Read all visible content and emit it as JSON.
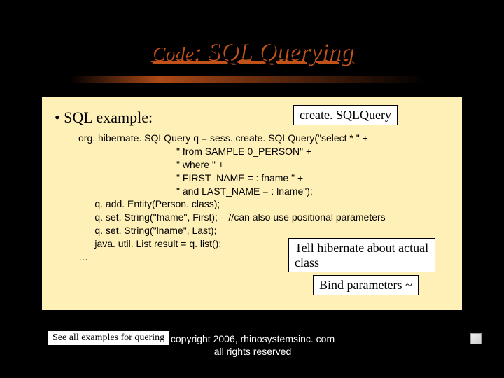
{
  "title": {
    "w1": "Code",
    "w2": ": SQL Querying"
  },
  "bullet": "SQL example:",
  "callouts": {
    "createSQLQuery": "create. SQLQuery",
    "tellHibernate": "Tell hibernate about actual class",
    "bindParams": "Bind parameters ~"
  },
  "code": "org. hibernate. SQLQuery q = sess. create. SQLQuery(\"select * \" +\n                                    \" from SAMPLE 0_PERSON\" +\n                                    \" where \" +\n                                    \" FIRST_NAME = : fname \" +\n                                    \" and LAST_NAME = : lname\");\n      q. add. Entity(Person. class);\n      q. set. String(\"fname\", First);    //can also use positional parameters\n      q. set. String(\"lname\", Last);\n      java. util. List result = q. list();\n…",
  "footerButton": "See all examples for quering",
  "copyright": "copyright 2006, rhinosystemsinc. com all rights reserved"
}
